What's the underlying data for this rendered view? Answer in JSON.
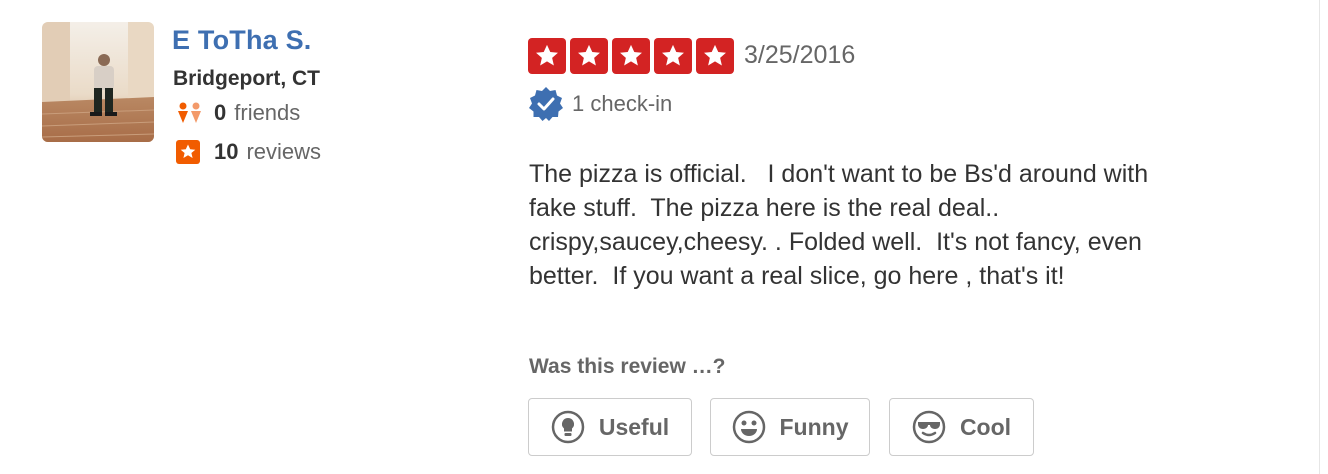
{
  "user": {
    "name": "E ToTha S.",
    "location": "Bridgeport, CT",
    "friends_count": "0",
    "friends_label": "friends",
    "reviews_count": "10",
    "reviews_label": "reviews",
    "avatar_icon": "user-photo"
  },
  "review": {
    "rating": 5,
    "rating_max": 5,
    "date": "3/25/2016",
    "checkin_text": "1 check-in",
    "text": "The pizza is official.   I don't want to be Bs'd around with\nfake stuff.  The pizza here is the real deal..\ncrispy,saucey,cheesy. . Folded well.  It's not fancy, even\nbetter.  If you want a real slice, go here , that's it!"
  },
  "votes": {
    "prompt": "Was this review …?",
    "useful_label": "Useful",
    "funny_label": "Funny",
    "cool_label": "Cool"
  },
  "colors": {
    "star_red": "#d32323",
    "name_blue": "#3e6fb1",
    "badge_orange": "#f15c00",
    "checkin_blue": "#3e6fb1"
  }
}
